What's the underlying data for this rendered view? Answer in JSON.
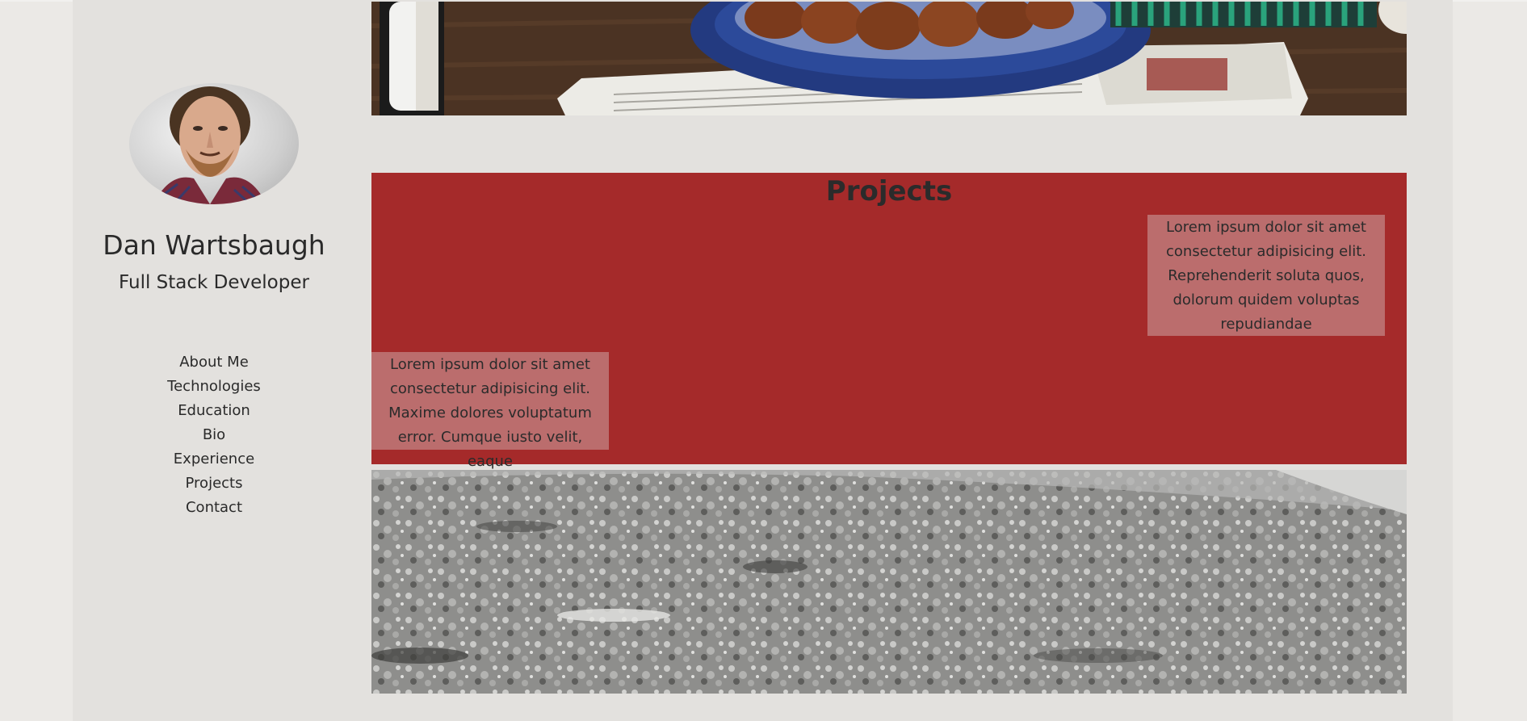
{
  "profile": {
    "name": "Dan Wartsbaugh",
    "role": "Full Stack Developer"
  },
  "nav": {
    "items": [
      {
        "label": "About Me"
      },
      {
        "label": "Technologies"
      },
      {
        "label": "Education"
      },
      {
        "label": "Bio"
      },
      {
        "label": "Experience"
      },
      {
        "label": "Projects"
      },
      {
        "label": "Contact"
      }
    ]
  },
  "projects": {
    "title": "Projects",
    "cards": [
      {
        "text": "Lorem ipsum dolor sit amet consectetur adipisicing elit. Reprehenderit soluta quos, dolorum quidem voluptas repudiandae"
      },
      {
        "text": "Lorem ipsum dolor sit amet consectetur adipisicing elit. Maxime dolores voluptatum error. Cumque iusto velit, eaque"
      }
    ]
  },
  "colors": {
    "page_background": "#e3e1de",
    "projects_background": "#a52a2a",
    "card_background": "#c89696"
  },
  "images": {
    "avatar": "avatar-photo",
    "hero_top": "breakfast-table-photo",
    "hero_bottom": "frosted-ground-photo"
  }
}
